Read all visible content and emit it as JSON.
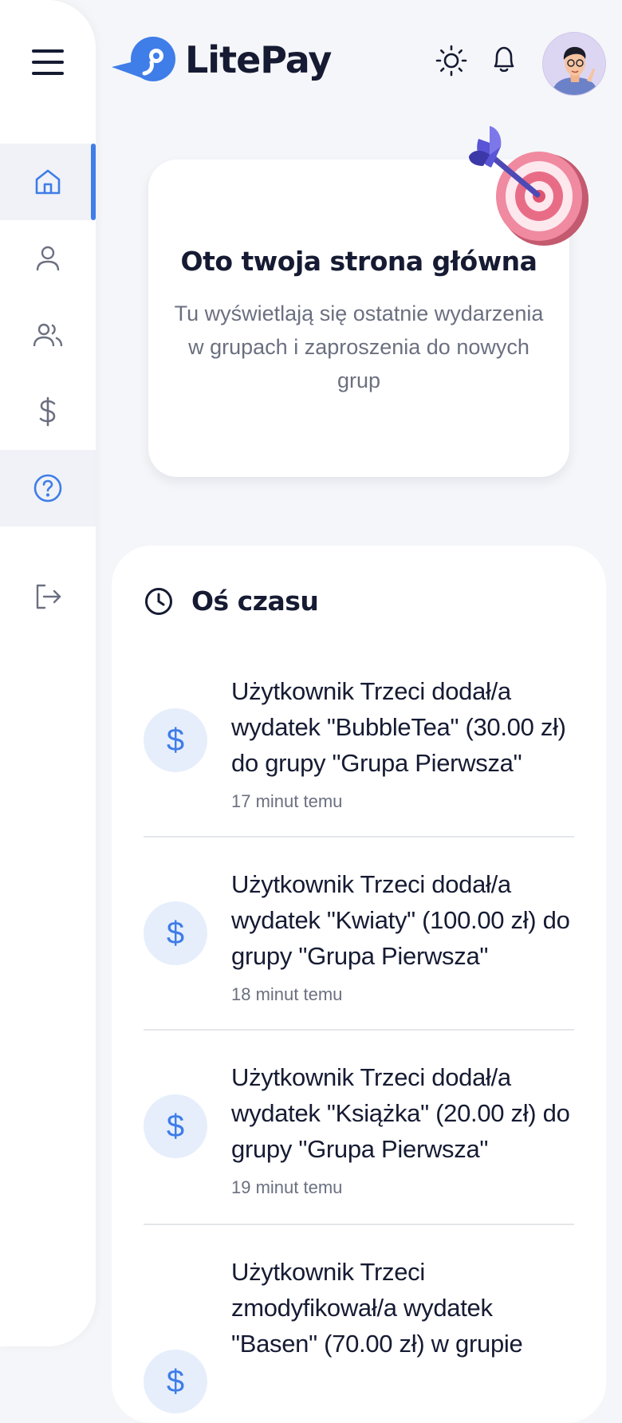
{
  "app": {
    "name": "LitePay"
  },
  "colors": {
    "accent": "#3f7de8",
    "text": "#161b33",
    "muted": "#6b7080",
    "background": "#f5f6f9"
  },
  "sidebar": {
    "items": [
      {
        "icon": "home-icon",
        "active": true
      },
      {
        "icon": "user-icon"
      },
      {
        "icon": "users-icon"
      },
      {
        "icon": "dollar-icon"
      },
      {
        "icon": "help-icon"
      },
      {
        "icon": "logout-icon"
      }
    ]
  },
  "header": {
    "icons": [
      "sun-icon",
      "bell-icon"
    ],
    "avatar": "avatar"
  },
  "hero": {
    "title": "Oto twoja strona główna",
    "description": "Tu wyświetlają się ostatnie wydarzenia w grupach i zaproszenia do nowych grup"
  },
  "timeline": {
    "title": "Oś czasu",
    "items": [
      {
        "text": "Użytkownik Trzeci dodał/a wydatek \"BubbleTea\" (30.00 zł) do grupy \"Grupa Pierwsza\"",
        "time": "17 minut temu",
        "icon": "dollar-icon"
      },
      {
        "text": "Użytkownik Trzeci dodał/a wydatek \"Kwiaty\" (100.00 zł) do grupy \"Grupa Pierwsza\"",
        "time": "18 minut temu",
        "icon": "dollar-icon"
      },
      {
        "text": "Użytkownik Trzeci dodał/a wydatek \"Książka\" (20.00 zł) do grupy \"Grupa Pierwsza\"",
        "time": "19 minut temu",
        "icon": "dollar-icon"
      },
      {
        "text": "Użytkownik Trzeci zmodyfikował/a wydatek \"Basen\" (70.00 zł) w grupie",
        "time": "",
        "icon": "dollar-icon"
      }
    ],
    "badge_symbol": "$"
  }
}
